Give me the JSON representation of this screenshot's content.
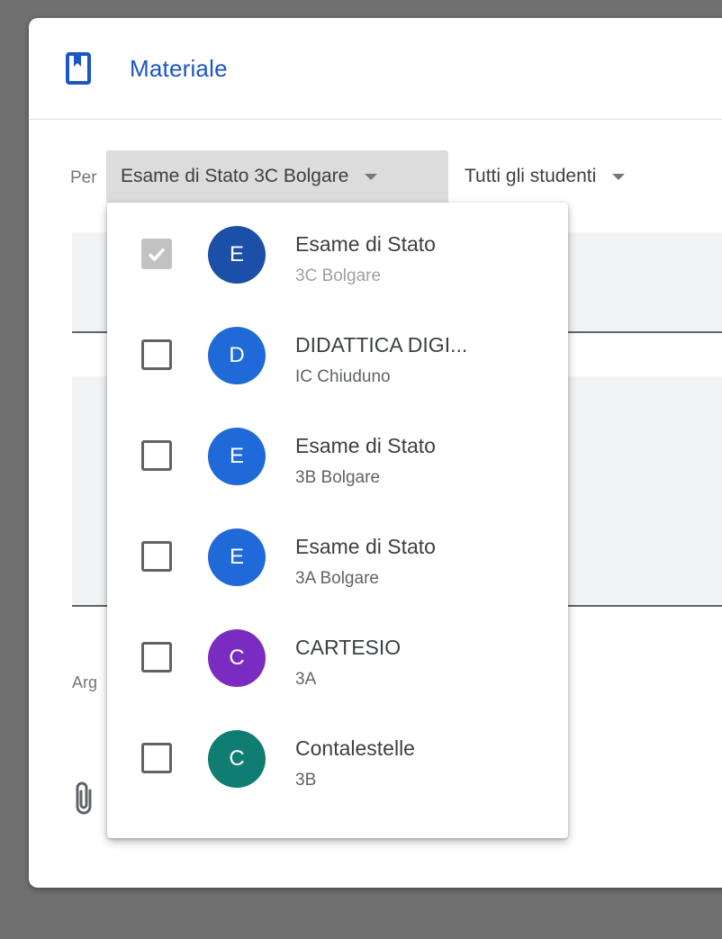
{
  "dialog": {
    "title": "Materiale",
    "for_label": "Per",
    "class_select": "Esame di Stato 3C Bolgare",
    "students_select": "Tutti gli studenti",
    "topic_label": "Arg"
  },
  "class_menu": {
    "items": [
      {
        "name": "Esame di Stato",
        "section": "3C Bolgare",
        "initial": "E",
        "color": "#1c4fa8",
        "checked": true
      },
      {
        "name": "DIDATTICA DIGI...",
        "section": "IC Chiuduno",
        "initial": "D",
        "color": "#1f6ad8",
        "checked": false
      },
      {
        "name": "Esame di Stato",
        "section": "3B Bolgare",
        "initial": "E",
        "color": "#1f6ad8",
        "checked": false
      },
      {
        "name": "Esame di Stato",
        "section": "3A Bolgare",
        "initial": "E",
        "color": "#1f6ad8",
        "checked": false
      },
      {
        "name": "CARTESIO",
        "section": "3A",
        "initial": "C",
        "color": "#7b2cc0",
        "checked": false
      },
      {
        "name": "Contalestelle",
        "section": "3B",
        "initial": "C",
        "color": "#0f7d72",
        "checked": false
      }
    ]
  },
  "icons": {
    "header": "bookmark-book-icon",
    "attach": "paperclip-icon"
  },
  "colors": {
    "accent": "#1a56c4",
    "backdrop": "#6f6f6f"
  }
}
